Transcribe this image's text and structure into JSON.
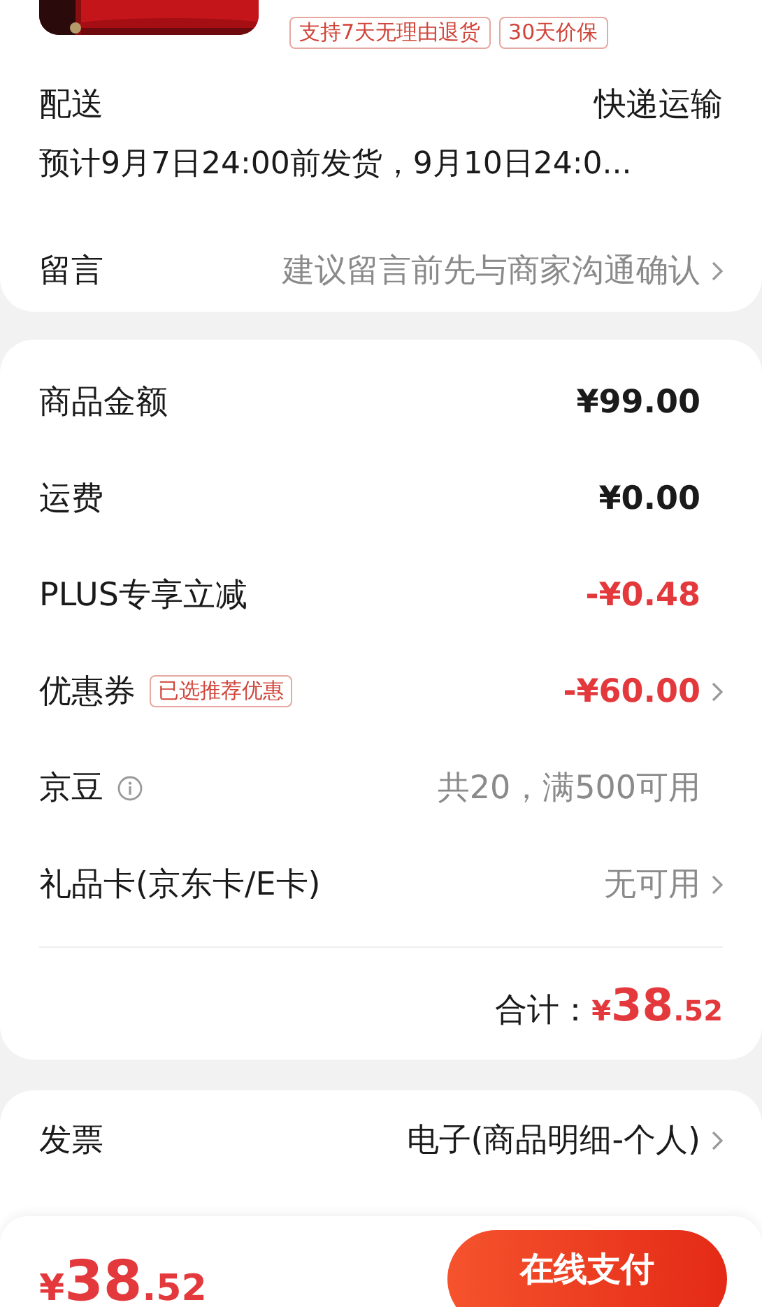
{
  "product": {
    "tags": [
      "支持7天无理由退货",
      "30天价保"
    ]
  },
  "delivery": {
    "label": "配送",
    "method": "快递运输",
    "estimate": "预计9月7日24:00前发货，9月10日24:0..."
  },
  "message": {
    "label": "留言",
    "placeholder": "建议留言前先与商家沟通确认",
    "chevron": true
  },
  "summary": {
    "rows": [
      {
        "label": "商品金额",
        "value": "¥99.00",
        "kind": "amount",
        "chevron": false,
        "info": false
      },
      {
        "label": "运费",
        "value": "¥0.00",
        "kind": "amount",
        "chevron": false,
        "info": false
      },
      {
        "label": "PLUS专享立减",
        "value": "-¥0.48",
        "kind": "discount",
        "chevron": false,
        "info": false
      },
      {
        "label": "优惠券",
        "badge": "已选推荐优惠",
        "value": "-¥60.00",
        "kind": "discount",
        "chevron": true,
        "info": false
      },
      {
        "label": "京豆",
        "value": "共20，满500可用",
        "kind": "note",
        "chevron": false,
        "info": true
      },
      {
        "label": "礼品卡(京东卡/E卡)",
        "value": "无可用",
        "kind": "note",
        "chevron": true,
        "info": false
      }
    ],
    "total": {
      "label": "合计：",
      "currency": "¥",
      "integer": "38",
      "decimal": ".52"
    }
  },
  "invoice": {
    "label": "发票",
    "value": "电子(商品明细-个人)",
    "chevron": true
  },
  "footer": {
    "currency": "¥",
    "integer": "38",
    "decimal": ".52",
    "pay_button": "在线支付"
  }
}
